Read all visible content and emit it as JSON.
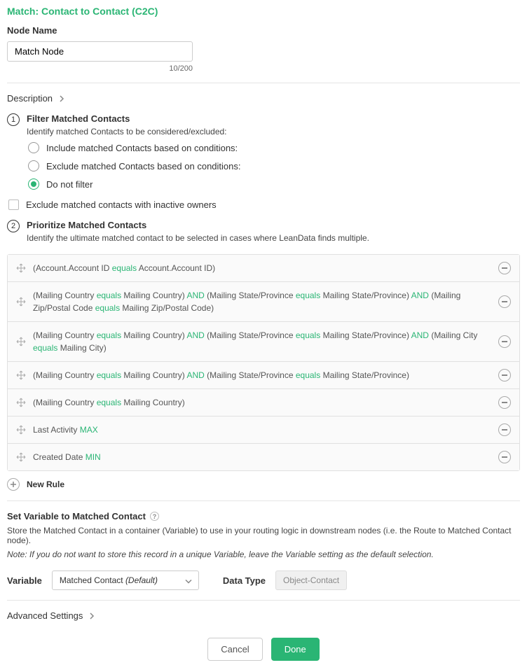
{
  "title": "Match: Contact to Contact (C2C)",
  "nodeName": {
    "label": "Node Name",
    "value": "Match Node",
    "count": "10/200"
  },
  "description": {
    "label": "Description"
  },
  "step1": {
    "num": "1",
    "title": "Filter Matched Contacts",
    "desc": "Identify matched Contacts to be considered/excluded:",
    "options": [
      {
        "label": "Include matched Contacts based on conditions:",
        "checked": false
      },
      {
        "label": "Exclude matched Contacts based on conditions:",
        "checked": false
      },
      {
        "label": "Do not filter",
        "checked": true
      }
    ],
    "excludeInactive": "Exclude matched contacts with inactive owners"
  },
  "step2": {
    "num": "2",
    "title": "Prioritize Matched Contacts",
    "desc": "Identify the ultimate matched contact to be selected in cases where LeanData finds multiple.",
    "rules": [
      [
        {
          "t": "txt",
          "v": "(Account.Account ID "
        },
        {
          "t": "op",
          "v": "equals"
        },
        {
          "t": "txt",
          "v": " Account.Account ID)"
        }
      ],
      [
        {
          "t": "txt",
          "v": "(Mailing Country "
        },
        {
          "t": "op",
          "v": "equals"
        },
        {
          "t": "txt",
          "v": " Mailing Country) "
        },
        {
          "t": "op",
          "v": "AND"
        },
        {
          "t": "txt",
          "v": " (Mailing State/Province "
        },
        {
          "t": "op",
          "v": "equals"
        },
        {
          "t": "txt",
          "v": " Mailing State/Province) "
        },
        {
          "t": "op",
          "v": "AND"
        },
        {
          "t": "txt",
          "v": " (Mailing Zip/Postal Code "
        },
        {
          "t": "op",
          "v": "equals"
        },
        {
          "t": "txt",
          "v": " Mailing Zip/Postal Code)"
        }
      ],
      [
        {
          "t": "txt",
          "v": "(Mailing Country "
        },
        {
          "t": "op",
          "v": "equals"
        },
        {
          "t": "txt",
          "v": " Mailing Country) "
        },
        {
          "t": "op",
          "v": "AND"
        },
        {
          "t": "txt",
          "v": " (Mailing State/Province "
        },
        {
          "t": "op",
          "v": "equals"
        },
        {
          "t": "txt",
          "v": " Mailing State/Province) "
        },
        {
          "t": "op",
          "v": "AND"
        },
        {
          "t": "txt",
          "v": " (Mailing City "
        },
        {
          "t": "op",
          "v": "equals"
        },
        {
          "t": "txt",
          "v": " Mailing City)"
        }
      ],
      [
        {
          "t": "txt",
          "v": "(Mailing Country "
        },
        {
          "t": "op",
          "v": "equals"
        },
        {
          "t": "txt",
          "v": " Mailing Country) "
        },
        {
          "t": "op",
          "v": "AND"
        },
        {
          "t": "txt",
          "v": " (Mailing State/Province "
        },
        {
          "t": "op",
          "v": "equals"
        },
        {
          "t": "txt",
          "v": " Mailing State/Province)"
        }
      ],
      [
        {
          "t": "txt",
          "v": "(Mailing Country "
        },
        {
          "t": "op",
          "v": "equals"
        },
        {
          "t": "txt",
          "v": " Mailing Country)"
        }
      ],
      [
        {
          "t": "txt",
          "v": "Last Activity "
        },
        {
          "t": "op",
          "v": "MAX"
        }
      ],
      [
        {
          "t": "txt",
          "v": "Created Date "
        },
        {
          "t": "op",
          "v": "MIN"
        }
      ]
    ],
    "newRule": "New Rule"
  },
  "setVar": {
    "title": "Set Variable to Matched Contact",
    "desc": "Store the Matched Contact in a container (Variable) to use in your routing logic in downstream nodes (i.e. the Route to Matched Contact node).",
    "note": "Note: If you do not want to store this record in a unique Variable, leave the Variable setting as the default selection.",
    "varLabel": "Variable",
    "varValue": "Matched Contact ",
    "varDefault": "(Default)",
    "dataTypeLabel": "Data Type",
    "dataTypeValue": "Object-Contact"
  },
  "advanced": {
    "label": "Advanced Settings"
  },
  "footer": {
    "cancel": "Cancel",
    "done": "Done"
  }
}
